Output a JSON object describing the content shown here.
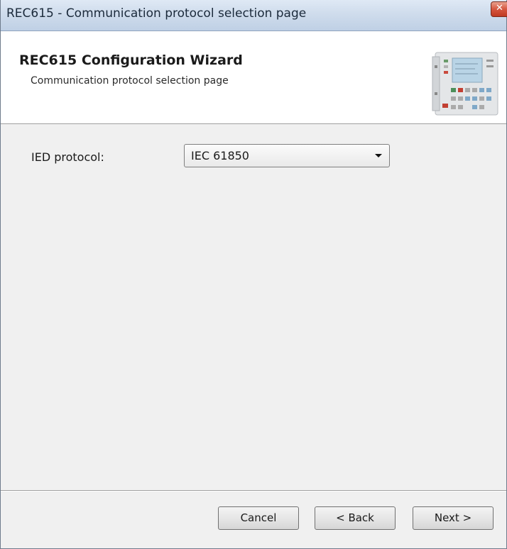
{
  "window": {
    "title": "REC615 - Communication protocol selection page",
    "close_icon": "close-icon"
  },
  "header": {
    "title": "REC615 Configuration Wizard",
    "subtitle": "Communication protocol selection page",
    "image_icon": "ied-device-image"
  },
  "form": {
    "protocol_label": "IED protocol:",
    "protocol_value": "IEC 61850",
    "dropdown_icon": "chevron-down-icon"
  },
  "footer": {
    "cancel_label": "Cancel",
    "back_label": "< Back",
    "next_label": "Next >"
  },
  "colors": {
    "titlebar": "#cfdcec",
    "close_button": "#d5563f",
    "window_background": "#f0f0f0",
    "header_background": "#ffffff"
  }
}
